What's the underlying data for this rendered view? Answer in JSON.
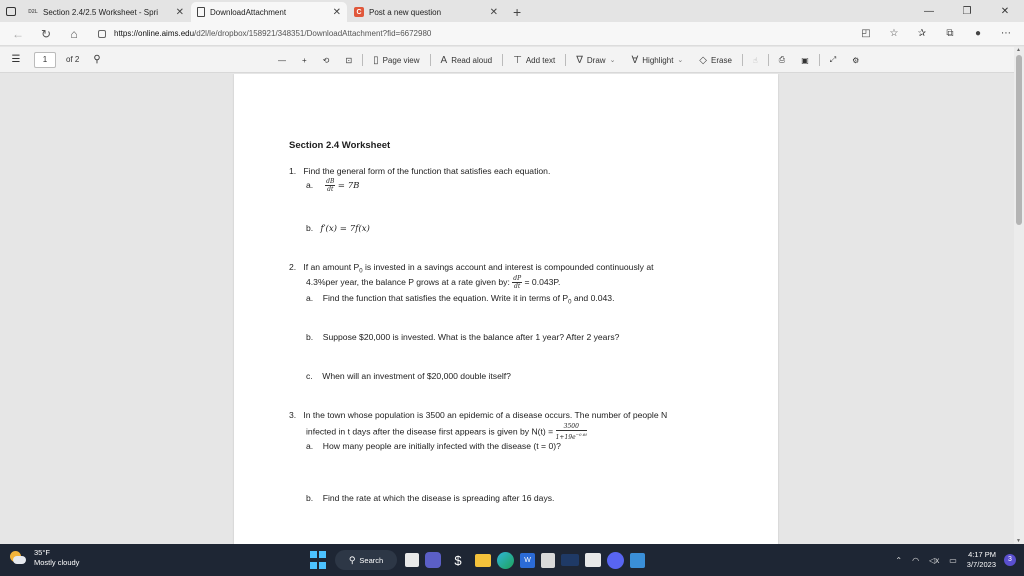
{
  "browser": {
    "tabs": [
      {
        "favicon": "d2l-icon",
        "favicon_text": "D2L",
        "title": "Section 2.4/2.5 Worksheet - Spri",
        "active": false
      },
      {
        "favicon": "document-icon",
        "title": "DownloadAttachment",
        "active": true
      },
      {
        "favicon": "chegg-icon",
        "favicon_text": "C",
        "title": "Post a new question",
        "active": false
      }
    ],
    "new_tab_symbol": "+",
    "window_controls": {
      "minimize": "—",
      "restore": "❐",
      "close": "✕"
    },
    "url_host": "https://online.aims.edu",
    "url_path": "/d2l/le/dropbox/158921/348351/DownloadAttachment?fid=6672980"
  },
  "pdf_toolbar": {
    "page_current": "1",
    "page_total_text": "of 2",
    "zoom_out": "—",
    "zoom_in": "+",
    "page_view": "Page view",
    "read_aloud": "Read aloud",
    "add_text": "Add text",
    "draw": "Draw",
    "highlight": "Highlight",
    "erase": "Erase"
  },
  "document": {
    "section_title": "Section 2.4 Worksheet",
    "q1": {
      "num": "1.",
      "text": "Find the general form of the function that satisfies each equation.",
      "a_label": "a.",
      "a_frac_num": "dB",
      "a_frac_den": "dt",
      "a_rhs": "= 7B",
      "b_label": "b.",
      "b_eq": "f′(x) = 7f(x)"
    },
    "q2": {
      "num": "2.",
      "line1": "If an amount P",
      "line1_sub": "0",
      "line1_rest": " is invested in a savings account and interest is compounded continuously at",
      "line2": "4.3%per year, the balance P grows at a rate given by:",
      "frac_num": "dP",
      "frac_den": "dt",
      "rhs": "= 0.043P.",
      "a_label": "a.",
      "a_text": "Find the function that satisfies the equation. Write it in terms of P",
      "a_sub": "0",
      "a_rest": " and 0.043.",
      "b_label": "b.",
      "b_text": "Suppose $20,000 is invested. What is the balance after 1 year? After 2 years?",
      "c_label": "c.",
      "c_text": "When will an investment of $20,000 double itself?"
    },
    "q3": {
      "num": "3.",
      "line1": "In the town whose population is 3500 an epidemic of a disease occurs. The number of people N",
      "line2": "infected in t days after the disease first appears is given by N(t) =",
      "frac_num": "3500",
      "frac_den": "1+19e",
      "frac_den_exp": "−0.6t",
      "a_label": "a.",
      "a_text": "How many people are initially infected with the disease (t = 0)?",
      "b_label": "b.",
      "b_text": "Find the rate at which the disease is spreading after 16 days."
    }
  },
  "taskbar": {
    "temperature": "35°F",
    "weather": "Mostly cloudy",
    "search_label": "Search",
    "time": "4:17 PM",
    "date": "3/7/2023",
    "notification_count": "3"
  }
}
